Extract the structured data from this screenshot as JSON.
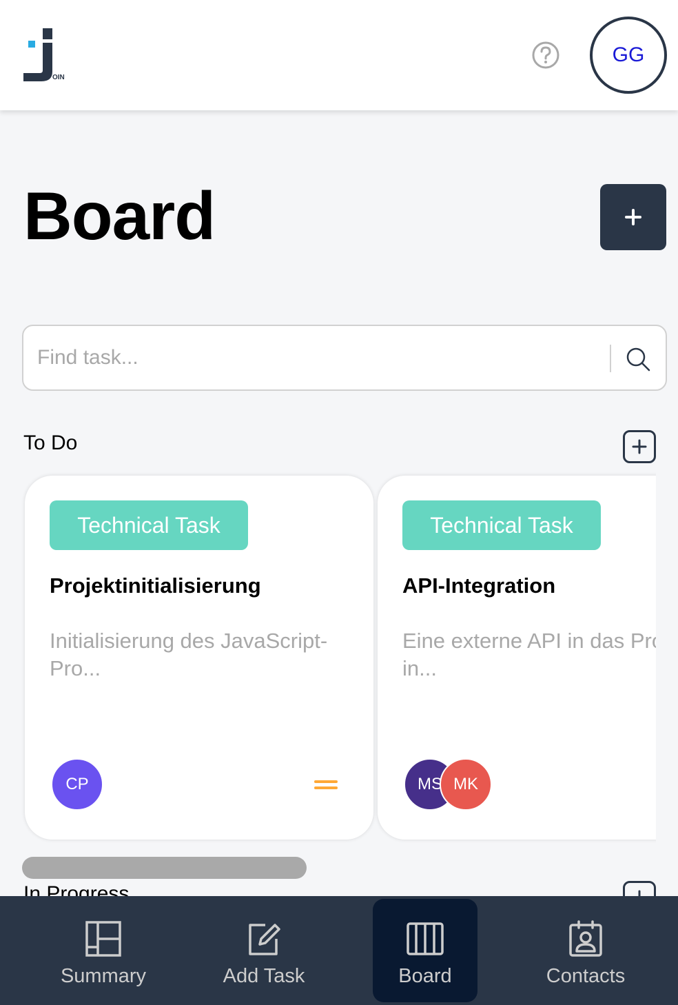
{
  "header": {
    "logo_text": "OIN",
    "user_initials": "GG"
  },
  "page_title": "Board",
  "search": {
    "placeholder": "Find task..."
  },
  "sections": [
    {
      "title": "To Do"
    },
    {
      "title": "In Progress"
    }
  ],
  "cards": [
    {
      "category": "Technical Task",
      "title": "Projektinitialisierung",
      "description": "Initialisierung des JavaScript-Pro...",
      "assignees": [
        {
          "initials": "CP",
          "color": "#6a52f0"
        }
      ],
      "priority_icon": "priority-medium-icon",
      "priority_color": "#ffa835"
    },
    {
      "category": "Technical Task",
      "title": "API-Integration",
      "description": "Eine externe API in das Projekt in...",
      "assignees": [
        {
          "initials": "MS",
          "color": "#462f8a"
        },
        {
          "initials": "MK",
          "color": "#e8584f"
        }
      ]
    }
  ],
  "nav": {
    "items": [
      {
        "label": "Summary",
        "icon": "summary-icon"
      },
      {
        "label": "Add Task",
        "icon": "add-task-icon"
      },
      {
        "label": "Board",
        "icon": "board-icon",
        "active": true
      },
      {
        "label": "Contacts",
        "icon": "contacts-icon"
      }
    ]
  },
  "colors": {
    "primary": "#2a3647",
    "nav_active": "#091931",
    "badge": "#66d6c1",
    "background": "#f5f6f8"
  }
}
